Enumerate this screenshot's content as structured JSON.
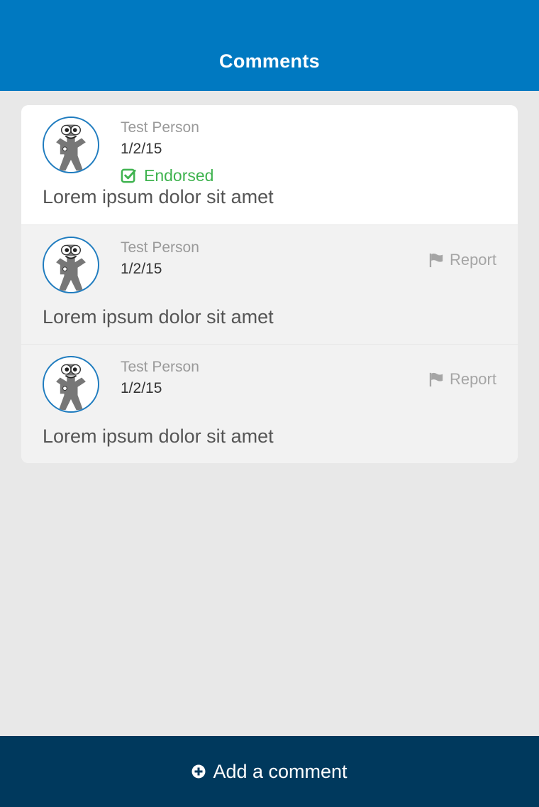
{
  "header": {
    "title": "Comments"
  },
  "comments": [
    {
      "author": "Test Person",
      "date": "1/2/15",
      "endorsed_label": "Endorsed",
      "text": "Lorem ipsum dolor sit amet",
      "endorsed": true
    },
    {
      "author": "Test Person",
      "date": "1/2/15",
      "report_label": "Report",
      "text": "Lorem ipsum dolor sit amet",
      "endorsed": false
    },
    {
      "author": "Test Person",
      "date": "1/2/15",
      "report_label": "Report",
      "text": "Lorem ipsum dolor sit amet",
      "endorsed": false
    }
  ],
  "footer": {
    "add_label": "Add a comment",
    "icon": "plus-circle-icon"
  },
  "colors": {
    "header": "#0079c1",
    "footer": "#00395d",
    "endorsed": "#3fb34f",
    "avatar_border": "#1f7cbf"
  }
}
